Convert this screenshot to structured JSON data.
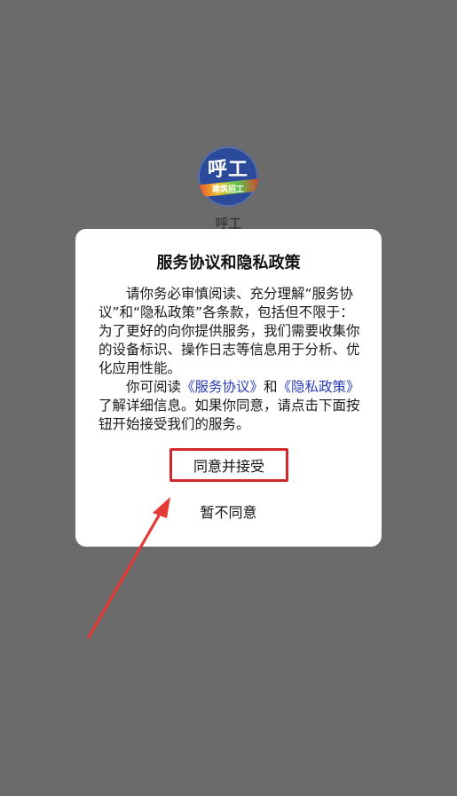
{
  "app": {
    "icon_text": "呼工",
    "icon_subtext": "建筑招工",
    "name": "呼工"
  },
  "dialog": {
    "title": "服务协议和隐私政策",
    "paragraph1": "请你务必审慎阅读、充分理解“服务协议”和“隐私政策”各条款，包括但不限于：为了更好的向你提供服务，我们需要收集你的设备标识、操作日志等信息用于分析、优化应用性能。",
    "paragraph2_prefix": "你可阅读",
    "service_link": "《服务协议》",
    "paragraph2_and": "和",
    "privacy_link": "《隐私政策》",
    "paragraph2_suffix": "了解详细信息。如果你同意，请点击下面按钮开始接受我们的服务。",
    "agree_label": "同意并接受",
    "disagree_label": "暂不同意"
  },
  "colors": {
    "backdrop": "#6b6b6b",
    "link": "#2a3db8",
    "highlight": "#d3282b"
  }
}
